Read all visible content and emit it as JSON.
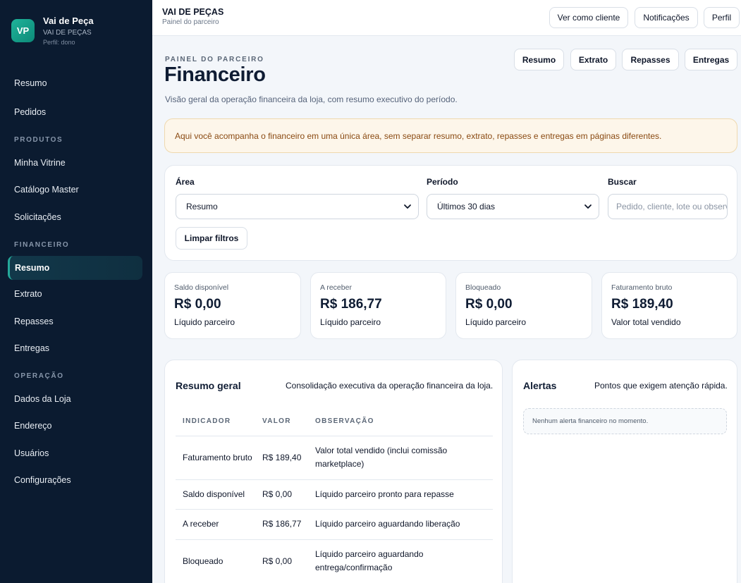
{
  "sidebar": {
    "brand": {
      "logo_text": "VP",
      "name": "Vai de Peça",
      "store": "VAI DE PEÇAS",
      "role": "Perfil: dono"
    },
    "items_top": [
      {
        "label": "Resumo"
      },
      {
        "label": "Pedidos"
      }
    ],
    "section_produtos": "PRODUTOS",
    "items_produtos": [
      {
        "label": "Minha Vitrine"
      },
      {
        "label": "Catálogo Master"
      },
      {
        "label": "Solicitações"
      }
    ],
    "section_financeiro": "FINANCEIRO",
    "items_financeiro": [
      {
        "label": "Resumo"
      },
      {
        "label": "Extrato"
      },
      {
        "label": "Repasses"
      },
      {
        "label": "Entregas"
      }
    ],
    "section_operacao": "OPERAÇÃO",
    "items_operacao": [
      {
        "label": "Dados da Loja"
      },
      {
        "label": "Endereço"
      },
      {
        "label": "Usuários"
      },
      {
        "label": "Configurações"
      }
    ]
  },
  "topbar": {
    "title": "VAI DE PEÇAS",
    "subtitle": "Painel do parceiro",
    "buttons": [
      {
        "label": "Ver como cliente"
      },
      {
        "label": "Notificações"
      },
      {
        "label": "Perfil"
      }
    ]
  },
  "header": {
    "eyebrow": "PAINEL DO PARCEIRO",
    "title": "Financeiro",
    "description": "Visão geral da operação financeira da loja, com resumo executivo do período.",
    "tabs": [
      {
        "label": "Resumo"
      },
      {
        "label": "Extrato"
      },
      {
        "label": "Repasses"
      },
      {
        "label": "Entregas"
      }
    ]
  },
  "notice": "Aqui você acompanha o financeiro em uma única área, sem separar resumo, extrato, repasses e entregas em páginas diferentes.",
  "filters": {
    "area_label": "Área",
    "area_value": "Resumo",
    "period_label": "Período",
    "period_value": "Últimos 30 dias",
    "search_label": "Buscar",
    "search_placeholder": "Pedido, cliente, lote ou observação",
    "clear_label": "Limpar filtros"
  },
  "stats": [
    {
      "label": "Saldo disponível",
      "value": "R$ 0,00",
      "foot": "Líquido parceiro"
    },
    {
      "label": "A receber",
      "value": "R$ 186,77",
      "foot": "Líquido parceiro"
    },
    {
      "label": "Bloqueado",
      "value": "R$ 0,00",
      "foot": "Líquido parceiro"
    },
    {
      "label": "Faturamento bruto",
      "value": "R$ 189,40",
      "foot": "Valor total vendido"
    }
  ],
  "summary": {
    "title": "Resumo geral",
    "subtitle": "Consolidação executiva da operação financeira da loja.",
    "columns": [
      "INDICADOR",
      "VALOR",
      "OBSERVAÇÃO"
    ],
    "rows": [
      {
        "indicator": "Faturamento bruto",
        "value": "R$ 189,40",
        "note": "Valor total vendido (inclui comissão marketplace)"
      },
      {
        "indicator": "Saldo disponível",
        "value": "R$ 0,00",
        "note": "Líquido parceiro pronto para repasse"
      },
      {
        "indicator": "A receber",
        "value": "R$ 186,77",
        "note": "Líquido parceiro aguardando liberação"
      },
      {
        "indicator": "Bloqueado",
        "value": "R$ 0,00",
        "note": "Líquido parceiro aguardando entrega/confirmação"
      }
    ]
  },
  "alerts": {
    "title": "Alertas",
    "subtitle": "Pontos que exigem atenção rápida.",
    "empty": "Nenhum alerta financeiro no momento."
  }
}
